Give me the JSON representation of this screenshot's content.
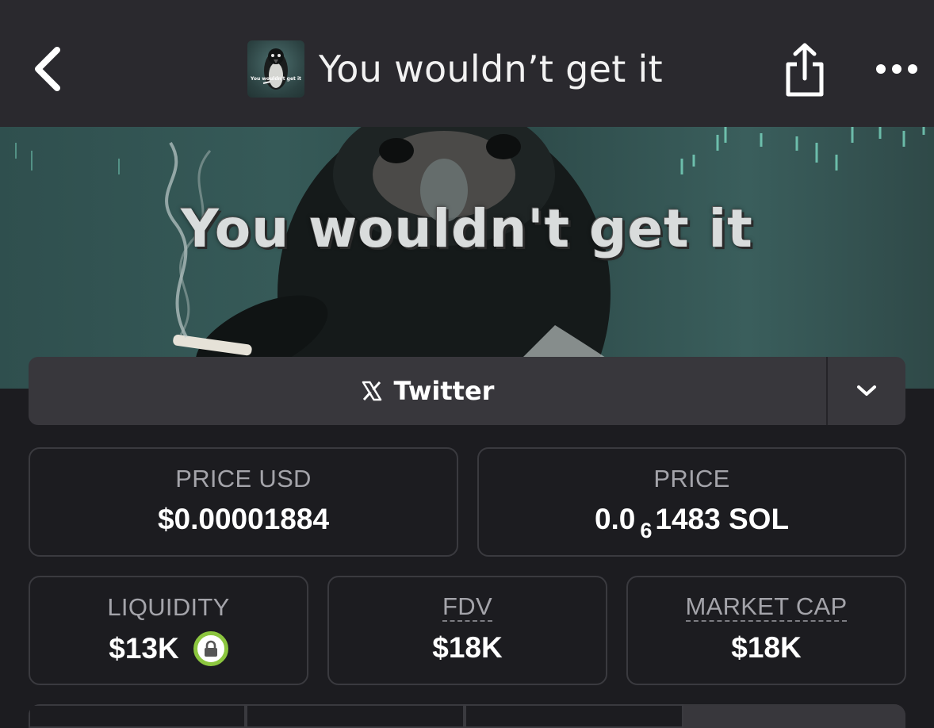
{
  "header": {
    "title": "You wouldn’t get it",
    "thumb_caption": "You wouldn't get it"
  },
  "banner": {
    "caption": "You wouldn't get it"
  },
  "social": {
    "twitter_label": "Twitter"
  },
  "stats": {
    "price_usd": {
      "label": "PRICE USD",
      "value": "$0.00001884"
    },
    "price": {
      "label": "PRICE",
      "prefix": "0.0",
      "subscript": "6",
      "suffix": "1483 SOL"
    },
    "liquidity": {
      "label": "LIQUIDITY",
      "value": "$13K"
    },
    "fdv": {
      "label": "FDV",
      "value": "$18K"
    },
    "market_cap": {
      "label": "MARKET CAP",
      "value": "$18K"
    }
  },
  "colors": {
    "background": "#1c1c20",
    "header": "#2a292e",
    "card_border": "#3a3a3f",
    "label": "#a4a4aa",
    "lock_ring": "#8cc63f"
  },
  "icons": [
    "chevron-left-icon",
    "share-icon",
    "more-icon",
    "x-logo-icon",
    "chevron-down-icon",
    "lock-icon"
  ]
}
